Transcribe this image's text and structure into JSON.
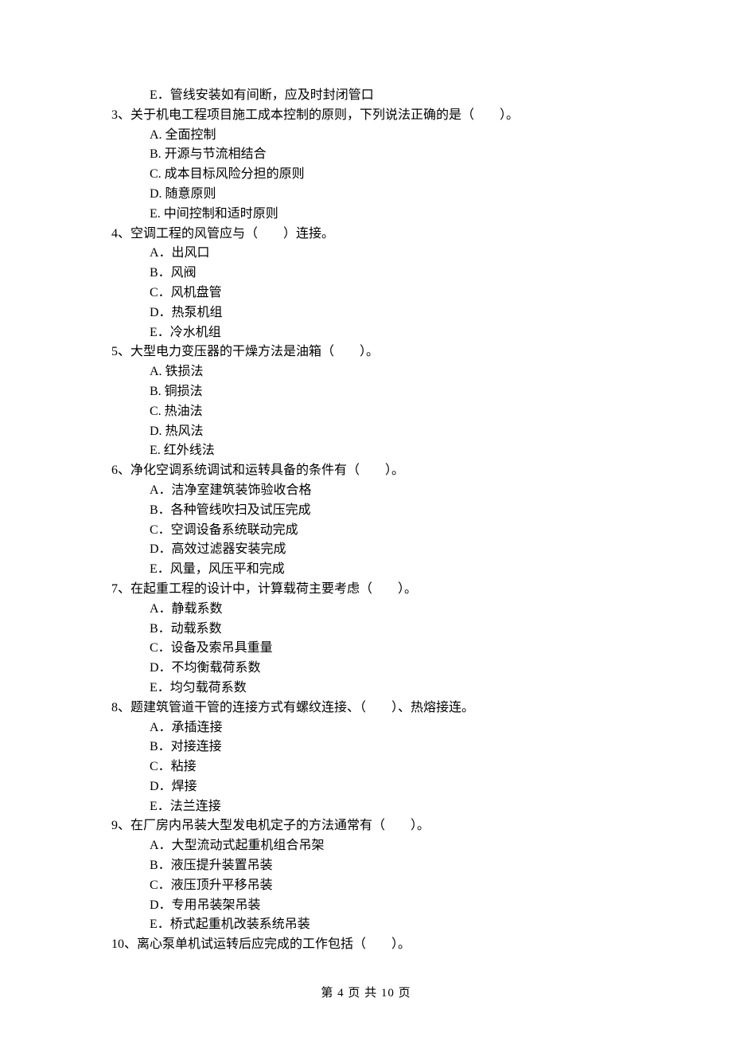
{
  "orphan_option": "E．管线安装如有间断，应及时封闭管口",
  "questions": [
    {
      "num": "3、",
      "stem": "关于机电工程项目施工成本控制的原则，下列说法正确的是（　　）。",
      "opts": [
        "A.  全面控制",
        "B.  开源与节流相结合",
        "C.  成本目标风险分担的原则",
        "D.  随意原则",
        "E.  中间控制和适时原则"
      ]
    },
    {
      "num": "4、",
      "stem": "空调工程的风管应与（　　）连接。",
      "opts": [
        "A．出风口",
        "B．风阀",
        "C．风机盘管",
        "D．热泵机组",
        "E．冷水机组"
      ]
    },
    {
      "num": "5、",
      "stem": "大型电力变压器的干燥方法是油箱（　　）。",
      "opts": [
        "A. 铁损法",
        "B. 铜损法",
        "C. 热油法",
        "D. 热风法",
        "E. 红外线法"
      ]
    },
    {
      "num": "6、",
      "stem": "净化空调系统调试和运转具备的条件有（　　）。",
      "opts": [
        "A．洁净室建筑装饰验收合格",
        "B．各种管线吹扫及试压完成",
        "C．空调设备系统联动完成",
        "D．高效过滤器安装完成",
        "E．风量，风压平和完成"
      ]
    },
    {
      "num": "7、",
      "stem": "在起重工程的设计中，计算载荷主要考虑（　　）。",
      "opts": [
        "A．静载系数",
        "B．动载系数",
        "C．设备及索吊具重量",
        "D．不均衡载荷系数",
        "E．均匀载荷系数"
      ]
    },
    {
      "num": "8、",
      "stem": "题建筑管道干管的连接方式有螺纹连接、（　　）、热熔接连。",
      "opts": [
        "A．承插连接",
        "B．对接连接",
        "C．粘接",
        "D．焊接",
        "E．法兰连接"
      ]
    },
    {
      "num": "9、",
      "stem": "在厂房内吊装大型发电机定子的方法通常有（　　）。",
      "opts": [
        "A．大型流动式起重机组合吊架",
        "B．液压提升装置吊装",
        "C．液压顶升平移吊装",
        "D．专用吊装架吊装",
        "E．桥式起重机改装系统吊装"
      ]
    },
    {
      "num": "10、",
      "stem": "离心泵单机试运转后应完成的工作包括（　　）。",
      "opts": []
    }
  ],
  "footer": "第 4 页 共 10 页"
}
